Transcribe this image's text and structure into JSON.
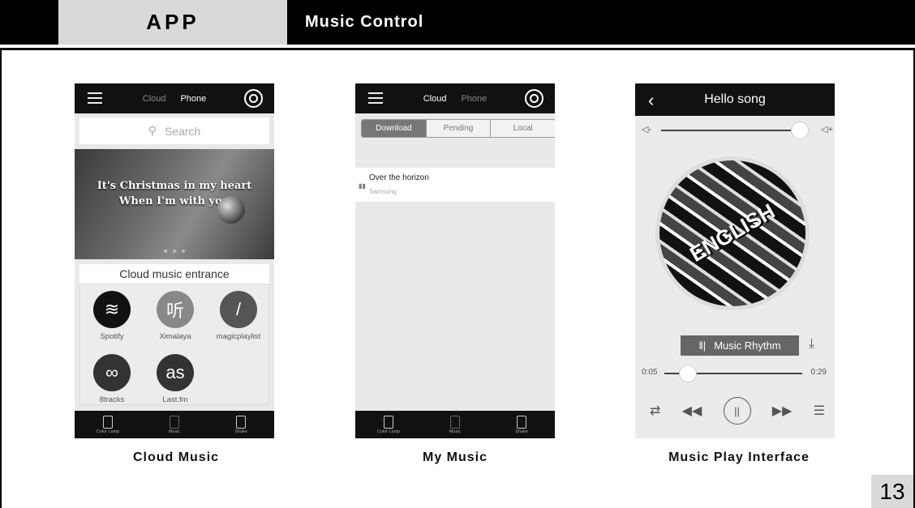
{
  "header": {
    "app_label": "APP",
    "section_title": "Music Control"
  },
  "page_number": "13",
  "captions": {
    "cloud": "Cloud Music",
    "my": "My Music",
    "play": "Music Play Interface"
  },
  "phone1": {
    "tabs": [
      "Cloud",
      "Phone"
    ],
    "active_tab": "Phone",
    "search_placeholder": "Search",
    "banner_line1": "It's Christmas in my heart",
    "banner_line2": "When I'm with you",
    "section_title": "Cloud music entrance",
    "services": [
      {
        "label": "Spotify",
        "icon": "spotify-icon",
        "glyph": "≋"
      },
      {
        "label": "Ximalaya",
        "icon": "ximalaya-icon",
        "glyph": "听"
      },
      {
        "label": "magicplaylist",
        "icon": "magicplaylist-icon",
        "glyph": "/"
      },
      {
        "label": "8tracks",
        "icon": "8tracks-icon",
        "glyph": "∞"
      },
      {
        "label": "Last.fm",
        "icon": "lastfm-icon",
        "glyph": "as"
      }
    ]
  },
  "bottom_nav": [
    {
      "label": "Color Lamp",
      "icon": "lamp-icon"
    },
    {
      "label": "Music",
      "icon": "music-icon"
    },
    {
      "label": "Shake",
      "icon": "shake-icon"
    }
  ],
  "phone2": {
    "tabs": [
      "Cloud",
      "Phone"
    ],
    "active_tab": "Cloud",
    "segments": [
      "Download",
      "Pending",
      "Local"
    ],
    "active_segment": "Download",
    "track": {
      "title": "Over the horizon",
      "artist": "Samsung"
    }
  },
  "phone3": {
    "title": "Hello song",
    "volume": 0.95,
    "disc_text": "ENGLISH",
    "rhythm_label": "Music Rhythm",
    "current_time": "0:05",
    "total_time": "0:29",
    "progress": 0.17
  }
}
